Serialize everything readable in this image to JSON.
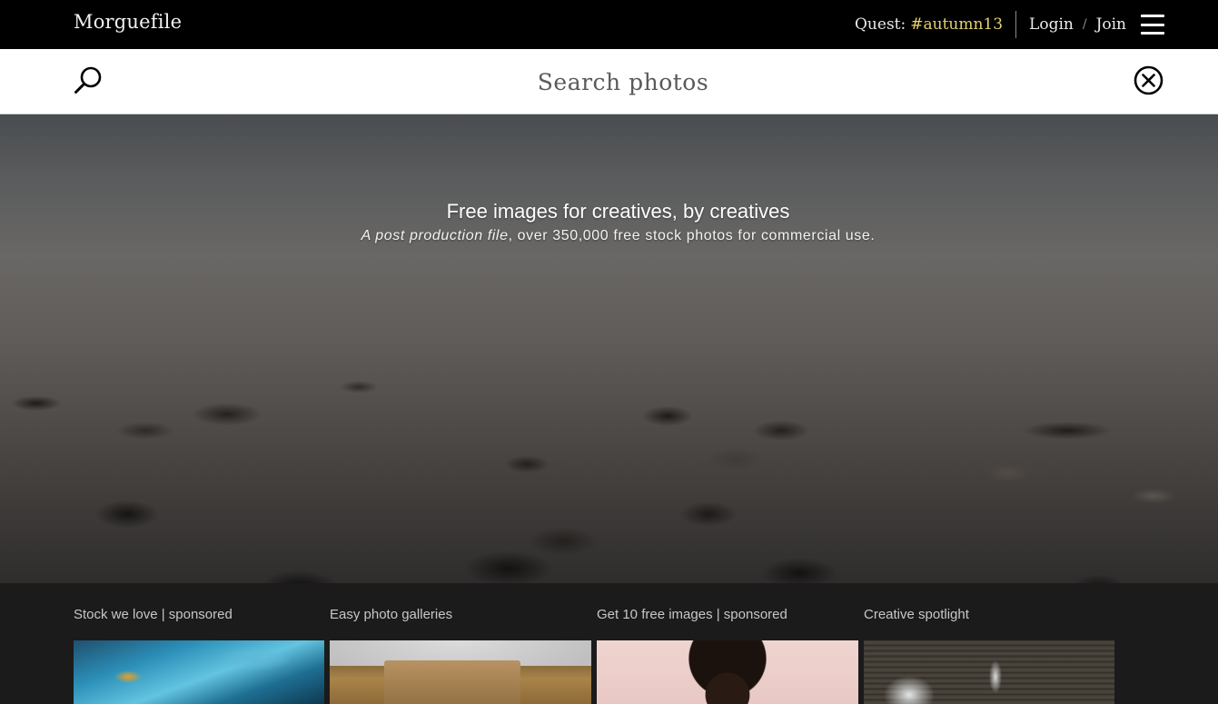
{
  "header": {
    "brand": "Morguefile",
    "quest_label": "Quest:",
    "quest_tag": "#autumn13",
    "login_label": "Login",
    "separator": "/",
    "join_label": "Join",
    "menu_icon": "hamburger-menu-icon"
  },
  "search": {
    "placeholder": "Search photos",
    "value": "",
    "search_icon": "search-icon",
    "clear_icon": "close-circle-icon"
  },
  "hero": {
    "title": "Free images for creatives, by creatives",
    "subtitle_em": "A post production file",
    "subtitle_rest": ", over 350,000 free stock photos for commercial use."
  },
  "cards": [
    {
      "title": "Stock we love | sponsored"
    },
    {
      "title": "Easy photo galleries"
    },
    {
      "title": "Get 10 free images | sponsored"
    },
    {
      "title": "Creative spotlight"
    }
  ],
  "colors": {
    "topbar_bg": "#000000",
    "quest_tag": "#e3d36a",
    "bottom_bg": "#1b1b1b"
  }
}
